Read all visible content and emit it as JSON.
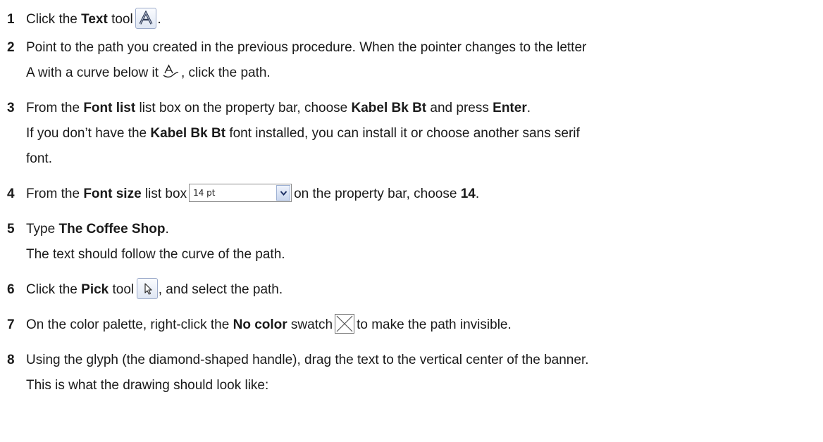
{
  "steps": [
    {
      "num": "1",
      "parts": [
        "Click the ",
        "Text",
        " tool",
        "."
      ]
    },
    {
      "num": "2",
      "line1": "Point to the path you created in the previous procedure. When the pointer changes to the letter",
      "line2_a": "A with a curve below it",
      "line2_b": ", click the path."
    },
    {
      "num": "3",
      "parts": [
        "From the ",
        "Font list",
        " list box on the property bar, choose ",
        "Kabel Bk Bt",
        " and press ",
        "Enter",
        "."
      ],
      "note_parts": [
        "If you don’t have the ",
        "Kabel Bk Bt",
        " font installed, you can install it or choose another sans serif"
      ],
      "note_line2": "font."
    },
    {
      "num": "4",
      "parts": [
        "From the ",
        "Font size",
        " list box",
        "on the property bar, choose ",
        "14",
        "."
      ],
      "combo_value": "14 pt"
    },
    {
      "num": "5",
      "parts": [
        "Type ",
        "The Coffee Shop",
        "."
      ],
      "note": "The text should follow the curve of the path."
    },
    {
      "num": "6",
      "parts": [
        "Click the ",
        "Pick",
        " tool",
        ", and select the path."
      ]
    },
    {
      "num": "7",
      "parts": [
        "On the color palette, right-click the ",
        "No color",
        " swatch",
        "to make the path invisible."
      ]
    },
    {
      "num": "8",
      "line1": "Using the glyph (the diamond-shaped handle), drag the text to the vertical center of the banner.",
      "note": "This is what the drawing should look like:"
    }
  ],
  "icons": {
    "text_tool": "text-tool-icon",
    "text_on_path_cursor": "text-on-path-cursor-icon",
    "dropdown_arrow": "chevron-down-icon",
    "pick_tool": "pick-tool-icon",
    "no_color_swatch": "no-color-swatch-icon"
  }
}
